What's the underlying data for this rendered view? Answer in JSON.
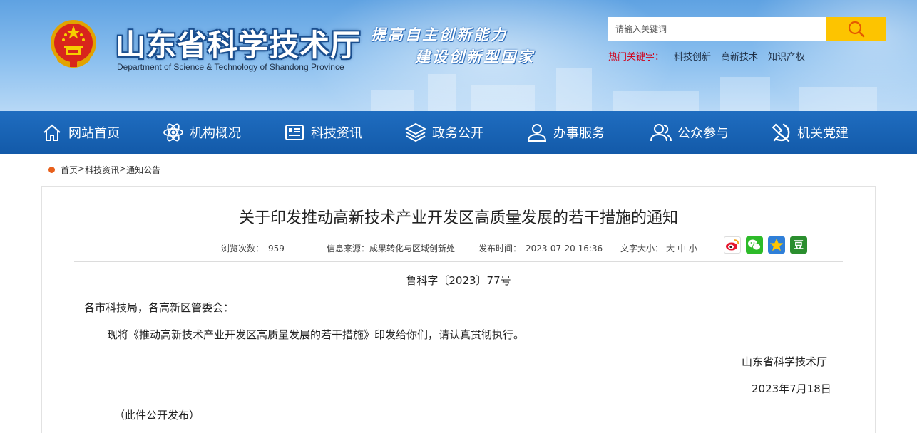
{
  "header": {
    "site_title": "山东省科学技术厅",
    "site_subtitle": "Department of Science & Technology of Shandong Province",
    "slogan_line1": "提高自主创新能力",
    "slogan_line2": "建设创新型国家",
    "search_placeholder": "请输入关键词",
    "hot_label": "热门关键字：",
    "hot_keywords": [
      "科技创新",
      "高新技术",
      "知识产权"
    ]
  },
  "nav": {
    "items": [
      {
        "label": "网站首页",
        "icon": "home-icon"
      },
      {
        "label": "机构概况",
        "icon": "atom-icon"
      },
      {
        "label": "科技资讯",
        "icon": "news-icon"
      },
      {
        "label": "政务公开",
        "icon": "layers-icon"
      },
      {
        "label": "办事服务",
        "icon": "user-icon"
      },
      {
        "label": "公众参与",
        "icon": "users-icon"
      },
      {
        "label": "机关党建",
        "icon": "party-emblem-icon"
      }
    ]
  },
  "breadcrumb": {
    "items": [
      "首页",
      "科技资讯",
      "通知公告"
    ],
    "separator": ">"
  },
  "article": {
    "title": "关于印发推动高新技术产业开发区高质量发展的若干措施的通知",
    "meta": {
      "views_label": "浏览次数：",
      "views_value": "959",
      "source_label": "信息来源：",
      "source_value": "成果转化与区域创新处",
      "time_label": "发布时间：",
      "time_value": "2023-07-20 16:36",
      "fontsize_label": "文字大小：",
      "fontsize_options": [
        "大",
        "中",
        "小"
      ]
    },
    "share": [
      "weibo-icon",
      "wechat-icon",
      "qzone-icon",
      "douban-icon"
    ],
    "douban_glyph": "豆",
    "doc_number": "鲁科字〔2023〕77号",
    "salutation": "各市科技局，各高新区管委会：",
    "paragraph": "现将《推动高新技术产业开发区高质量发展的若干措施》印发给你们，请认真贯彻执行。",
    "sign_org": "山东省科学技术厅",
    "sign_date": "2023年7月18日",
    "release_note": "（此件公开发布）"
  },
  "colors": {
    "nav_bg": "#1a64b6",
    "search_button": "#fdc400",
    "hot_label": "#d0021b",
    "breadcrumb_dot": "#e8601c"
  }
}
